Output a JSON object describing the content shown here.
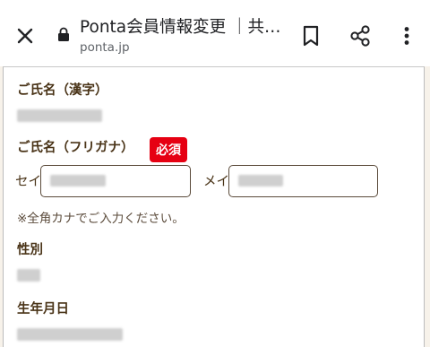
{
  "browser": {
    "title": "Ponta会員情報変更 ｜共通ポイント Ponta",
    "url": "ponta.jp",
    "icons": [
      "close-icon",
      "lock-icon",
      "bookmark-icon",
      "share-icon",
      "more-vert-icon"
    ]
  },
  "form": {
    "kanji_name": {
      "label": "ご氏名（漢字）"
    },
    "kana_name": {
      "label": "ご氏名（フリガナ）",
      "required_badge": "必須",
      "sei_prefix": "セイ",
      "mei_prefix": "メイ",
      "note": "※全角カナでご入力ください。"
    },
    "gender": {
      "label": "性別"
    },
    "birthday": {
      "label": "生年月日"
    }
  },
  "colors": {
    "label_text": "#4a3418",
    "required_badge_bg": "#e60012",
    "field_border": "#5a4a3a",
    "page_background": "#f7f2ea"
  }
}
